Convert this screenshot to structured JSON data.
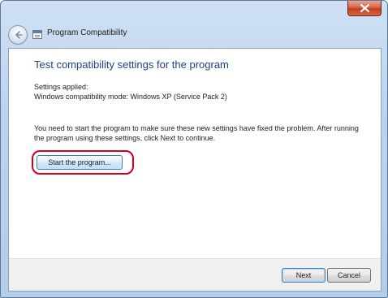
{
  "window": {
    "title": "Program Compatibility"
  },
  "page": {
    "heading": "Test compatibility settings for the program",
    "applied_label": "Settings applied:",
    "mode_text": "Windows compatibility mode: Windows XP (Service Pack 2)",
    "info_text": "You need to start the program to make sure these new settings have fixed the problem. After running the program using these settings, click Next to continue.",
    "start_button": "Start the program..."
  },
  "footer": {
    "next_label": "Next",
    "cancel_label": "Cancel"
  },
  "colors": {
    "heading": "#1f3f92",
    "highlight": "#d4001c",
    "close_button": "#c43c1f"
  },
  "icons": [
    "close-icon",
    "back-arrow-icon",
    "program-icon"
  ]
}
